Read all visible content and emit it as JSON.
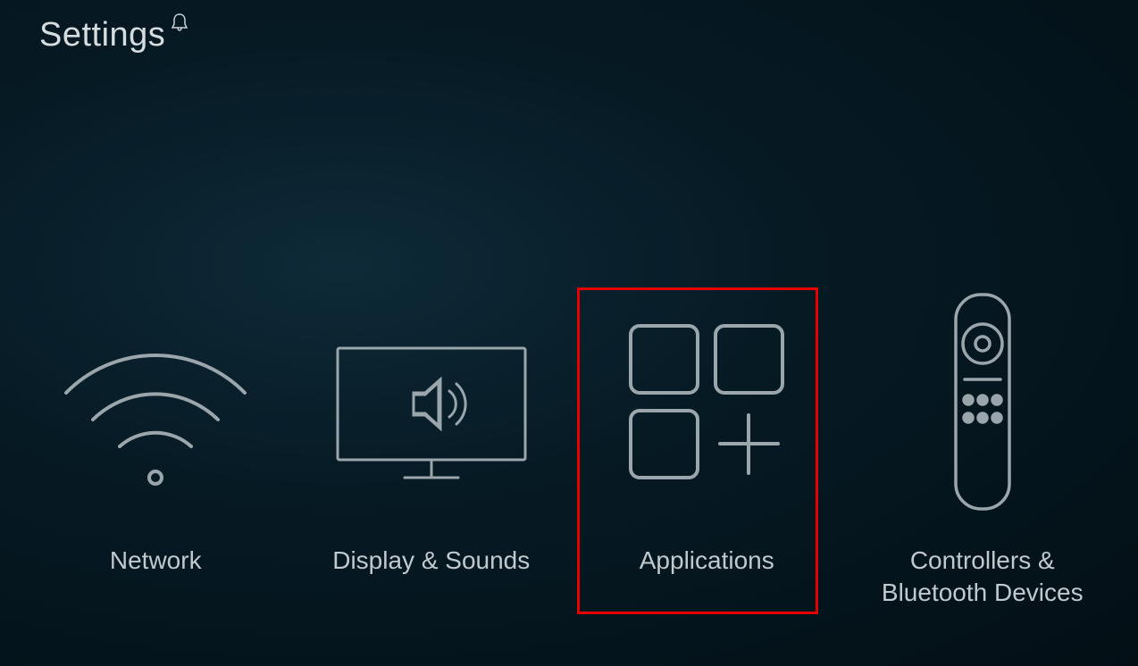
{
  "header": {
    "title": "Settings"
  },
  "tiles": [
    {
      "id": "network",
      "label": "Network",
      "icon": "wifi-icon"
    },
    {
      "id": "display-sounds",
      "label": "Display & Sounds",
      "icon": "display-sound-icon"
    },
    {
      "id": "applications",
      "label": "Applications",
      "icon": "apps-icon",
      "highlighted": true
    },
    {
      "id": "controllers-bluetooth",
      "label": "Controllers &\nBluetooth Devices",
      "icon": "remote-icon"
    }
  ]
}
